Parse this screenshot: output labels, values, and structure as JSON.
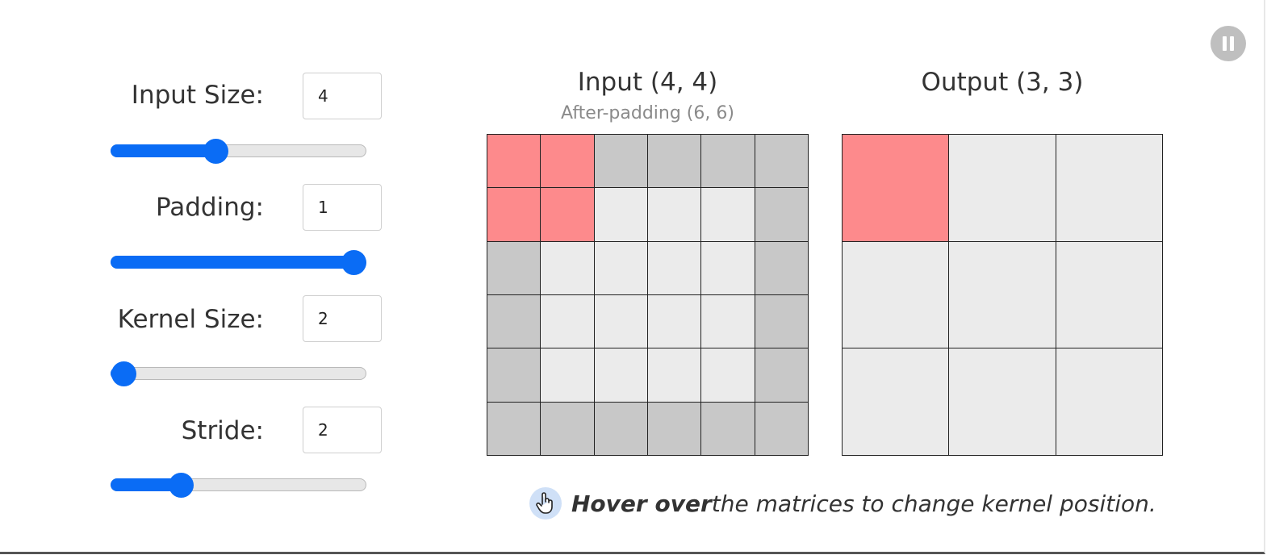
{
  "controls": [
    {
      "label": "Input Size:",
      "value": "4",
      "slider_fraction": 0.4
    },
    {
      "label": "Padding:",
      "value": "1",
      "slider_fraction": 1.0
    },
    {
      "label": "Kernel Size:",
      "value": "2",
      "slider_fraction": 0.0
    },
    {
      "label": "Stride:",
      "value": "2",
      "slider_fraction": 0.25
    }
  ],
  "input_matrix": {
    "title": "Input (4, 4)",
    "subtitle": "After-padding (6, 6)",
    "rows": 6,
    "cols": 6,
    "padding": 1,
    "highlighted": [
      [
        0,
        0
      ],
      [
        0,
        1
      ],
      [
        1,
        0
      ],
      [
        1,
        1
      ]
    ]
  },
  "output_matrix": {
    "title": "Output (3, 3)",
    "rows": 3,
    "cols": 3,
    "highlighted": [
      [
        0,
        0
      ]
    ]
  },
  "hint": {
    "bold": "Hover over",
    "rest": " the matrices to change kernel position.",
    "icon": "pointer-hand-icon"
  },
  "colors": {
    "accent": "#0a6cf5",
    "kernel_highlight": "#fd8a8c",
    "padding_cell": "#c8c8c8",
    "cell": "#ebebeb"
  }
}
